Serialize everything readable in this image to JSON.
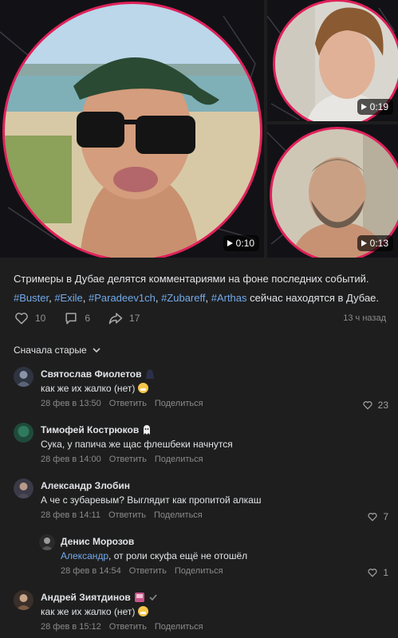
{
  "media": {
    "videos": [
      {
        "duration": "0:10",
        "subject": "man in cap and sunglasses on beach"
      },
      {
        "duration": "0:19",
        "subject": "young man with curly hair"
      },
      {
        "duration": "0:13",
        "subject": "bearded man"
      }
    ]
  },
  "post": {
    "line1": "Стримеры в Дубае делятся комментариями на фоне последних событий.",
    "tags": [
      "#Buster",
      "#Exile",
      "#Paradeev1ch",
      "#Zubareff",
      "#Arthas"
    ],
    "tag_sep": ", ",
    "tail": " сейчас находятся в Дубае."
  },
  "actions": {
    "likes": "10",
    "comments": "6",
    "shares": "17",
    "time_ago": "13 ч назад"
  },
  "sort": {
    "label": "Сначала старые"
  },
  "comments": [
    {
      "author": "Святослав Фиолетов",
      "text": "как же их жалко (нет)",
      "date": "28 фев в 13:50",
      "reply": "Ответить",
      "share": "Поделиться",
      "likes": "23"
    },
    {
      "author": "Тимофей Кострюков",
      "text": "Сука, у папича же щас флешбеки начнутся",
      "date": "28 фев в 14:00",
      "reply": "Ответить",
      "share": "Поделиться",
      "likes": ""
    },
    {
      "author": "Александр Злобин",
      "text": "А че с зубаревым? Выглядит как пропитой алкаш",
      "date": "28 фев в 14:11",
      "reply": "Ответить",
      "share": "Поделиться",
      "likes": "7"
    },
    {
      "author": "Денис Морозов",
      "mention": "Александр",
      "text": ", от роли скуфа ещё не отошёл",
      "date": "28 фев в 14:54",
      "reply": "Ответить",
      "share": "Поделиться",
      "likes": "1"
    },
    {
      "author": "Андрей Зиятдинов",
      "text": "как же их жалко (нет)",
      "date": "28 фев в 15:12",
      "reply": "Ответить",
      "share": "Поделиться",
      "likes": ""
    }
  ],
  "colors": {
    "accent_pink": "#e0215a",
    "link": "#71aaeb",
    "bg": "#1e1e1e"
  }
}
